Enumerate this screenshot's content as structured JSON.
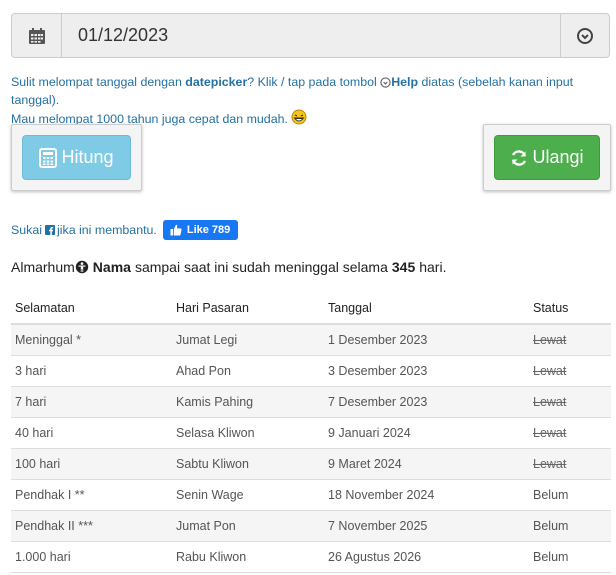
{
  "date_input": {
    "value": "01/12/2023",
    "left_icon": "calendar-icon",
    "right_icon": "clock-arrow-icon"
  },
  "help": {
    "line1_part1": "Sulit melompat tanggal dengan ",
    "datepicker": "datepicker",
    "line1_part2": "? Klik / tap pada tombol ",
    "help_label": "Help",
    "line1_part3": " diatas (sebelah kanan input tanggal).",
    "line2": "Mau melompat 1000 tahun juga cepat dan mudah. ",
    "line2_icon": "laughing-face-icon"
  },
  "buttons": {
    "hitung_label": "Hitung",
    "ulangi_label": "Ulangi"
  },
  "like_row": {
    "prefix": "Sukai ",
    "suffix": " jika ini membantu.",
    "like_label": "Like 789"
  },
  "sentence": {
    "prefix": "Almarhum ",
    "name": "Nama",
    "middle": " sampai saat ini sudah meninggal selama ",
    "days": "345",
    "suffix": " hari."
  },
  "table": {
    "headers": [
      "Selamatan",
      "Hari Pasaran",
      "Tanggal",
      "Status"
    ],
    "rows": [
      {
        "selamatan": "Meninggal *",
        "pasaran": "Jumat Legi",
        "tanggal": "1 Desember 2023",
        "status": "Lewat"
      },
      {
        "selamatan": "3 hari",
        "pasaran": "Ahad Pon",
        "tanggal": "3 Desember 2023",
        "status": "Lewat"
      },
      {
        "selamatan": "7 hari",
        "pasaran": "Kamis Pahing",
        "tanggal": "7 Desember 2023",
        "status": "Lewat"
      },
      {
        "selamatan": "40 hari",
        "pasaran": "Selasa Kliwon",
        "tanggal": "9 Januari 2024",
        "status": "Lewat"
      },
      {
        "selamatan": "100 hari",
        "pasaran": "Sabtu Kliwon",
        "tanggal": "9 Maret 2024",
        "status": "Lewat"
      },
      {
        "selamatan": "Pendhak I **",
        "pasaran": "Senin Wage",
        "tanggal": "18 November 2024",
        "status": "Belum"
      },
      {
        "selamatan": "Pendhak II ***",
        "pasaran": "Jumat Pon",
        "tanggal": "7 November 2025",
        "status": "Belum"
      },
      {
        "selamatan": "1.000 hari",
        "pasaran": "Rabu Kliwon",
        "tanggal": "26 Agustus 2026",
        "status": "Belum"
      }
    ]
  },
  "colors": {
    "link": "#2471a3",
    "hitung_bg": "#7fcbe5",
    "ulangi_bg": "#4cae4c",
    "facebook": "#1877f2"
  }
}
